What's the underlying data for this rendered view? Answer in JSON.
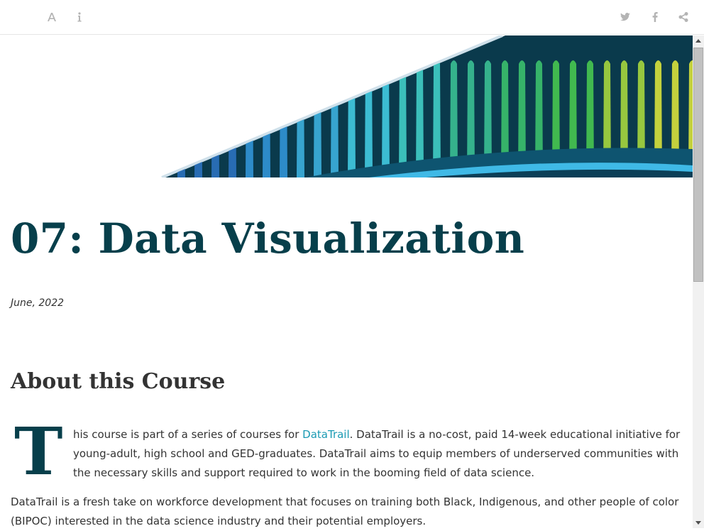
{
  "toolbar": {
    "left_icons": [
      "font-settings-icon",
      "info-icon"
    ],
    "right_icons": [
      "twitter-icon",
      "facebook-icon",
      "share-icon"
    ],
    "icon_color": "#b4b4b4"
  },
  "page": {
    "title": "07: Data Visualization",
    "date": "June, 2022",
    "section_heading": "About this Course",
    "dropcap": "T",
    "para1_rest_before": "his course is part of a series of courses for ",
    "para1_link": "DataTrail",
    "para1_rest_after": ". DataTrail is a no-cost, paid 14-week educational initiative for young-adult, high school and GED-graduates. DataTrail aims to equip members of underserved communities with the necessary skills and support required to work in the booming field of data science.",
    "para2": "DataTrail is a fresh take on workforce development that focuses on training both Black, Indigenous, and other people of color (BIPOC) interested in the data science industry and their potential employers."
  },
  "colors": {
    "title": "#073f4b",
    "link": "#1a9ab3",
    "banner_dark": "#0a3a4c"
  }
}
